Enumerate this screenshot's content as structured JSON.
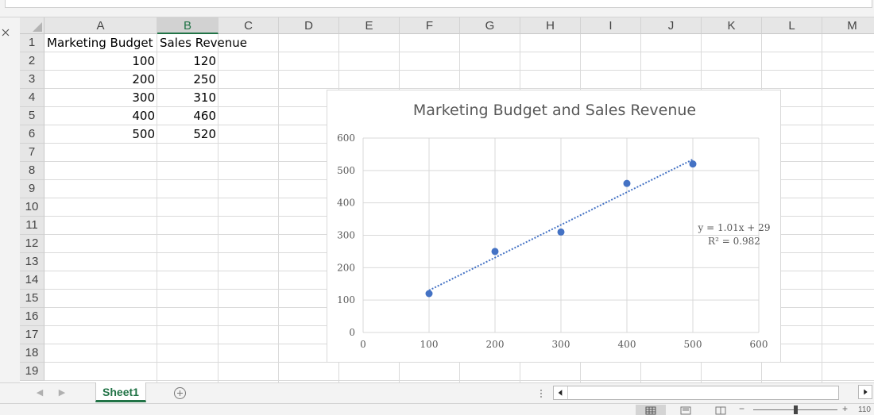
{
  "columns": [
    "A",
    "B",
    "C",
    "D",
    "E",
    "F",
    "G",
    "H",
    "I",
    "J",
    "K",
    "L",
    "M"
  ],
  "selected_column": "B",
  "rows": [
    "1",
    "2",
    "3",
    "4",
    "5",
    "6",
    "7",
    "8",
    "9",
    "10",
    "11",
    "12",
    "13",
    "14",
    "15",
    "16",
    "17",
    "18",
    "19"
  ],
  "cells": {
    "A1": "Marketing Budget",
    "B1": "Sales Revenue",
    "A2": "100",
    "B2": "120",
    "A3": "200",
    "B3": "250",
    "A4": "300",
    "B4": "310",
    "A5": "400",
    "B5": "460",
    "A6": "500",
    "B6": "520"
  },
  "chart_data": {
    "type": "scatter",
    "title": "Marketing Budget and Sales Revenue",
    "xlabel": "",
    "ylabel": "",
    "x": [
      100,
      200,
      300,
      400,
      500
    ],
    "y": [
      120,
      250,
      310,
      460,
      520
    ],
    "xlim": [
      0,
      600
    ],
    "ylim": [
      0,
      600
    ],
    "xticks": [
      "0",
      "100",
      "200",
      "300",
      "400",
      "500",
      "600"
    ],
    "yticks": [
      "0",
      "100",
      "200",
      "300",
      "400",
      "500",
      "600"
    ],
    "grid": true,
    "trendline": {
      "type": "linear",
      "slope": 1.01,
      "intercept": 29,
      "equation": "y = 1.01x + 29",
      "r_squared": "R² = 0.982"
    },
    "marker_color": "#4472c4",
    "trendline_color": "#4472c4"
  },
  "sheet_tabs": [
    {
      "label": "Sheet1",
      "active": true
    }
  ],
  "status": {
    "zoom_level": "110"
  },
  "icons": {
    "close": "close-icon",
    "add_sheet": "plus-circle-icon",
    "scroll_left": "chevron-left-icon",
    "scroll_right": "chevron-right-icon",
    "normal_view": "grid-view-icon",
    "page_layout": "page-layout-icon",
    "page_break": "page-break-icon"
  },
  "colors": {
    "accent": "#217346",
    "header_bg": "#e6e6e6",
    "selected_header_bg": "#d2d2d2",
    "gridline": "#dadada"
  }
}
